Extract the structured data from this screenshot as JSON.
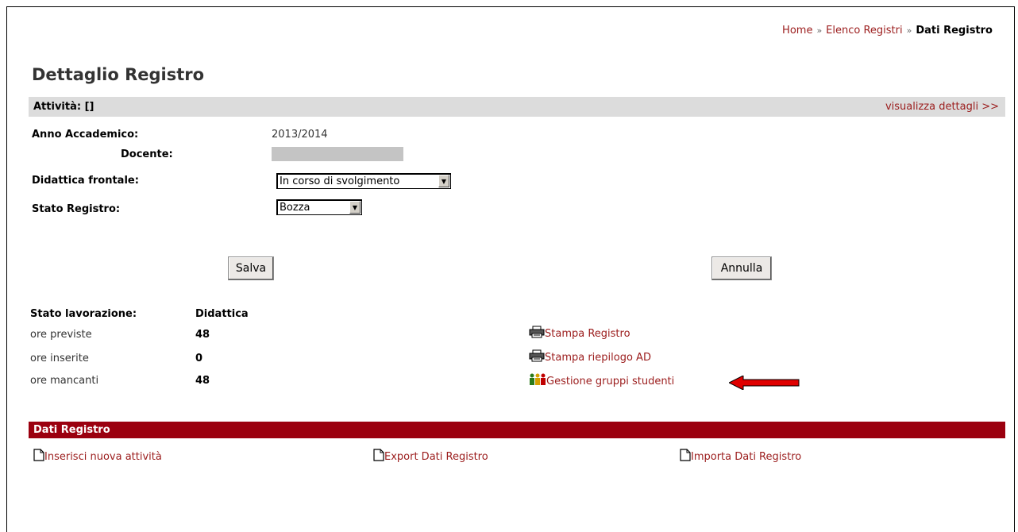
{
  "breadcrumb": {
    "home": "Home",
    "separator": "»",
    "list": "Elenco Registri",
    "current": "Dati Registro"
  },
  "page_title": "Dettaglio Registro",
  "activity": {
    "label": "Attività: []",
    "details_link": "visualizza dettagli >>"
  },
  "form": {
    "anno_label": "Anno Accademico:",
    "anno_value": "2013/2014",
    "docente_label": "Docente:",
    "didattica_label": "Didattica frontale:",
    "didattica_value": "In corso di svolgimento",
    "stato_label": "Stato Registro:",
    "stato_value": "Bozza",
    "save_label": "Salva",
    "cancel_label": "Annulla"
  },
  "stats": {
    "header_label": "Stato lavorazione:",
    "header_value": "Didattica",
    "rows": [
      {
        "label": "ore previste",
        "value": "48"
      },
      {
        "label": "ore inserite",
        "value": "0"
      },
      {
        "label": "ore mancanti",
        "value": "48"
      }
    ]
  },
  "actions": {
    "stampa_registro": "Stampa Registro",
    "stampa_riepilogo": "Stampa riepilogo AD",
    "gestione_gruppi": "Gestione gruppi studenti"
  },
  "dati_registro": {
    "title": "Dati Registro",
    "inserisci": "Inserisci nuova attività",
    "export": "Export Dati Registro",
    "importa": "Importa Dati Registro"
  },
  "colors": {
    "link": "#9b1c1c",
    "bar_gray": "#dcdcdc",
    "bar_red": "#9b000f",
    "arrow": "#e00000"
  },
  "icons": [
    "printer-icon",
    "group-icon",
    "document-icon",
    "arrow-left-icon"
  ]
}
